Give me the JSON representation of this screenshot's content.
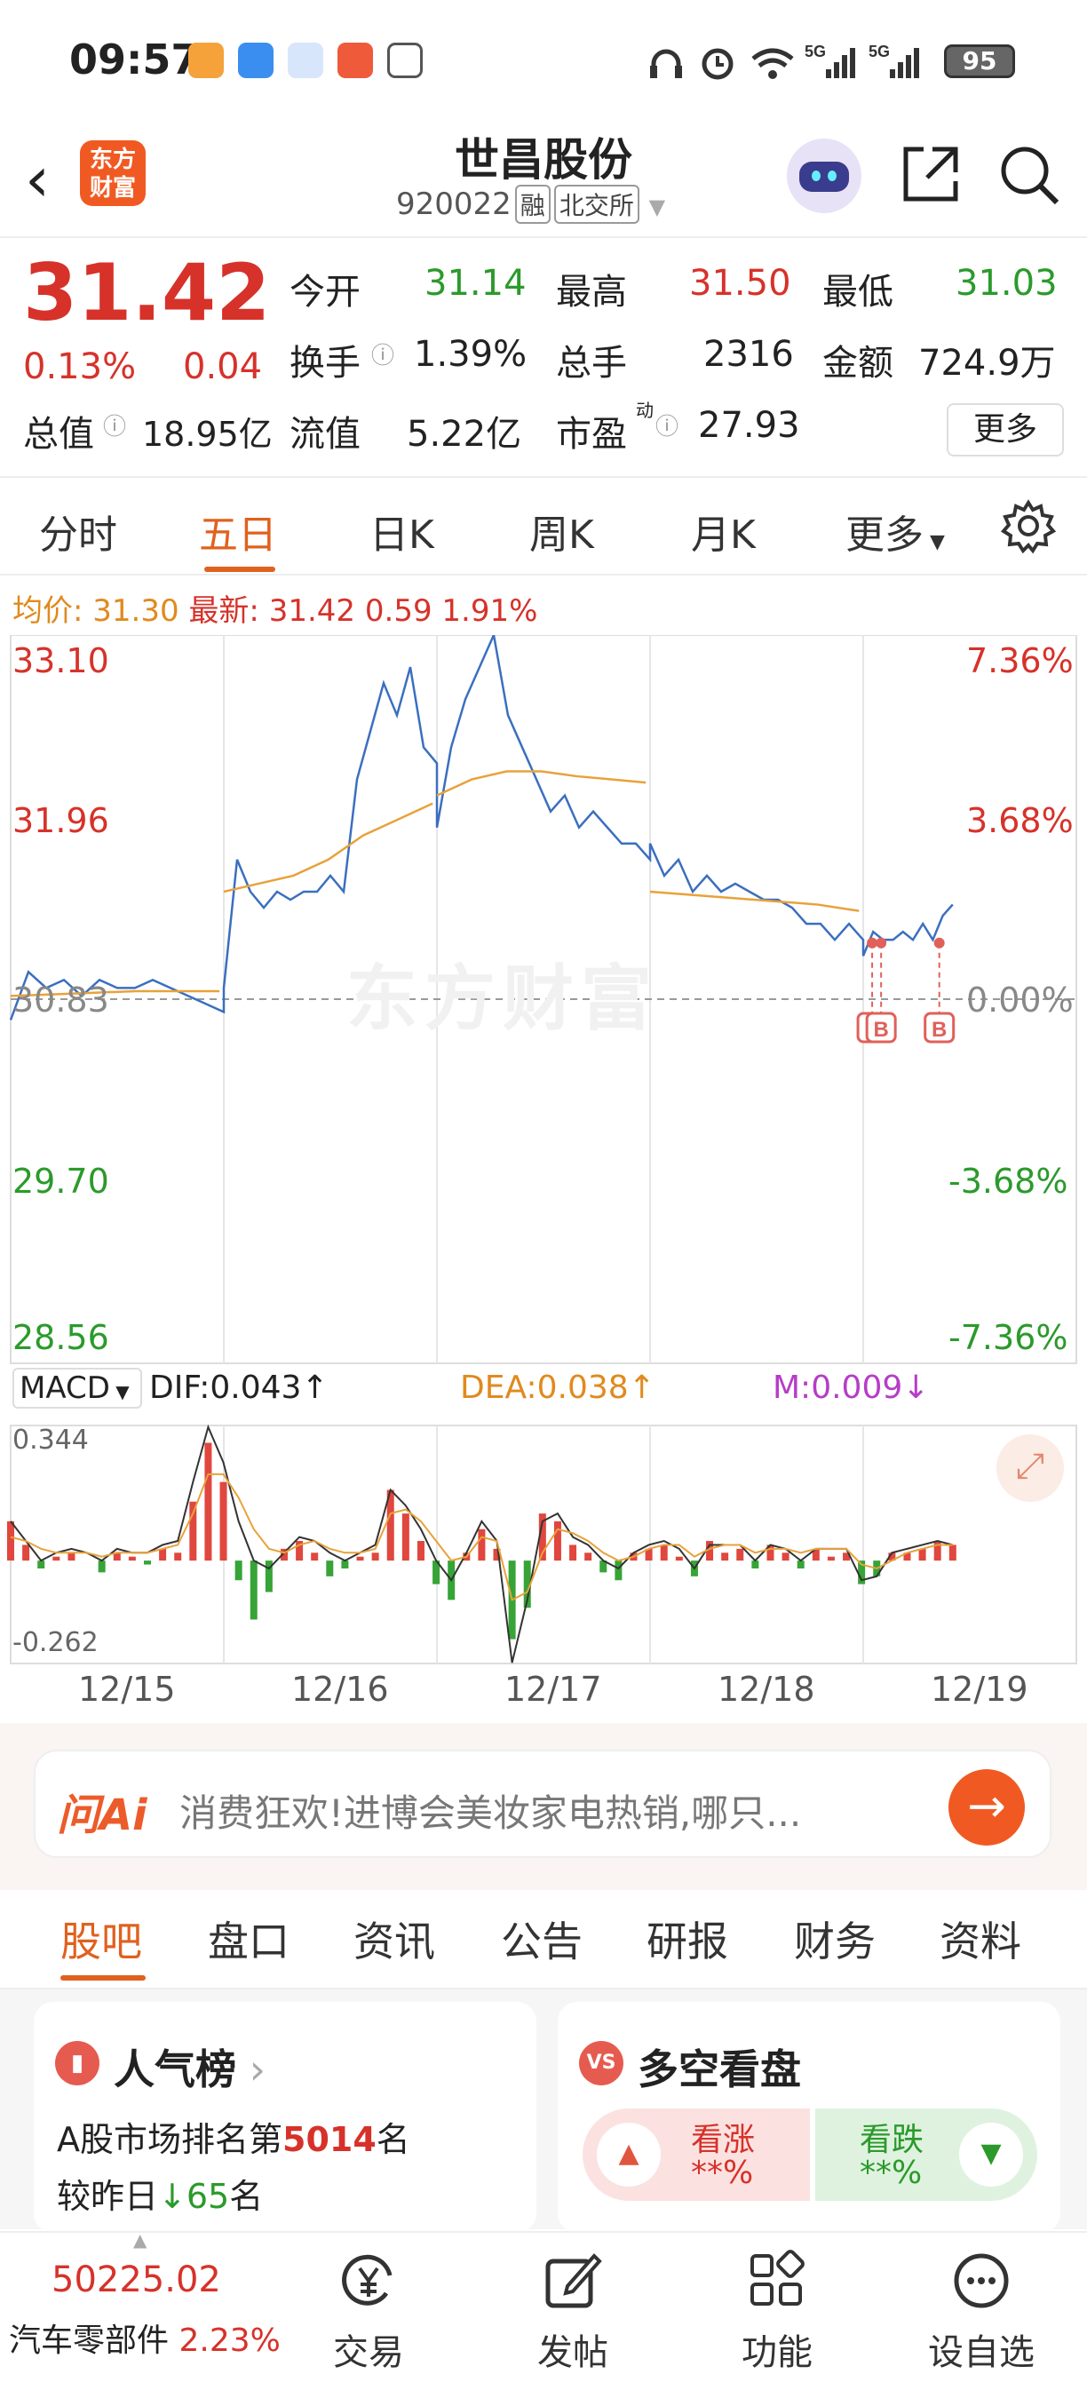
{
  "status_bar": {
    "time": "09:57",
    "network1": "5G",
    "network2": "5G",
    "battery": "95"
  },
  "header": {
    "logo_line1": "东方",
    "logo_line2": "财富",
    "stock_name": "世昌股份",
    "stock_code": "920022",
    "tag_margin": "融",
    "tag_exchange": "北交所"
  },
  "quote": {
    "price": "31.42",
    "change_pct": "0.13%",
    "change_amt": "0.04",
    "open_label": "今开",
    "open": "31.14",
    "high_label": "最高",
    "high": "31.50",
    "low_label": "最低",
    "low": "31.03",
    "turnover_label": "换手",
    "turnover": "1.39%",
    "volume_label": "总手",
    "volume": "2316",
    "amount_label": "金额",
    "amount": "724.9万",
    "mktcap_label": "总值",
    "mktcap": "18.95亿",
    "float_label": "流值",
    "float": "5.22亿",
    "pe_label": "市盈",
    "pe_sup": "动",
    "pe": "27.93",
    "more": "更多"
  },
  "tabs": [
    "分时",
    "五日",
    "日K",
    "周K",
    "月K",
    "更多"
  ],
  "info": {
    "avg_label": "均价:",
    "avg": "31.30",
    "latest_label": "最新:",
    "latest": "31.42",
    "change": "0.59",
    "change_pct": "1.91%"
  },
  "chart_data": {
    "type": "line",
    "title": "",
    "x_labels": [
      "12/15",
      "12/16",
      "12/17",
      "12/18",
      "12/19"
    ],
    "y_left_ticks": [
      "33.10",
      "31.96",
      "30.83",
      "29.70",
      "28.56"
    ],
    "y_right_ticks": [
      "7.36%",
      "3.68%",
      "0.00%",
      "-3.68%",
      "-7.36%"
    ],
    "ylim": [
      28.56,
      33.1
    ],
    "base_price": 30.83,
    "watermark": "东方财富",
    "series": [
      {
        "name": "price",
        "color": "#3b6fbf",
        "day_points": [
          [
            30.7,
            31.0,
            30.9,
            30.95,
            30.85,
            30.95,
            30.9,
            30.9,
            30.95,
            30.9,
            30.85,
            30.8,
            30.75
          ],
          [
            30.9,
            31.7,
            31.5,
            31.4,
            31.5,
            31.45,
            31.5,
            31.5,
            31.6,
            31.5,
            32.2,
            32.5,
            32.8,
            32.6,
            32.9,
            32.4,
            32.3
          ],
          [
            31.9,
            32.4,
            32.7,
            32.9,
            33.1,
            32.6,
            32.4,
            32.2,
            32.0,
            32.1,
            31.9,
            32.0,
            31.9,
            31.8,
            31.8,
            31.7
          ],
          [
            31.8,
            31.6,
            31.7,
            31.5,
            31.6,
            31.5,
            31.55,
            31.5,
            31.45,
            31.45,
            31.4,
            31.3,
            31.3,
            31.2,
            31.3,
            31.2
          ],
          [
            31.1,
            31.25,
            31.2,
            31.2,
            31.25,
            31.2,
            31.3,
            31.2,
            31.35,
            31.42
          ]
        ]
      },
      {
        "name": "avg",
        "color": "#e8a23a",
        "day_points": [
          [
            30.85,
            30.86,
            30.87,
            30.88,
            30.88,
            30.88
          ],
          [
            31.5,
            31.55,
            31.6,
            31.7,
            31.85,
            31.95,
            32.05
          ],
          [
            32.1,
            32.2,
            32.25,
            32.25,
            32.22,
            32.2,
            32.18
          ],
          [
            31.5,
            31.48,
            31.46,
            31.44,
            31.42,
            31.38
          ],
          []
        ]
      }
    ],
    "markers": [
      {
        "label": "B",
        "day": 4,
        "pos": 0.1
      },
      {
        "label": "B",
        "day": 4,
        "pos": 0.2
      },
      {
        "label": "B",
        "day": 4,
        "pos": 0.85
      }
    ]
  },
  "macd": {
    "selector": "MACD",
    "dif": "DIF:0.043",
    "dea": "DEA:0.038",
    "m": "M:0.009",
    "y_top": "0.344",
    "y_bottom": "-0.262",
    "hist": [
      0.1,
      0.04,
      -0.02,
      0.01,
      0.02,
      0.0,
      -0.03,
      0.02,
      0.01,
      -0.01,
      0.03,
      0.02,
      0.15,
      0.3,
      0.2,
      -0.05,
      -0.15,
      -0.08,
      0.03,
      0.05,
      0.02,
      -0.04,
      -0.02,
      0.01,
      0.02,
      0.18,
      0.12,
      0.05,
      -0.06,
      -0.1,
      0.02,
      0.08,
      0.03,
      -0.2,
      -0.12,
      0.12,
      0.1,
      0.04,
      0.02,
      -0.03,
      -0.05,
      0.02,
      0.03,
      0.04,
      0.01,
      -0.04,
      0.05,
      0.02,
      0.03,
      -0.02,
      0.04,
      0.02,
      -0.02,
      0.03,
      0.01,
      0.02,
      -0.06,
      -0.04,
      0.02,
      0.02,
      0.03,
      0.05,
      0.04
    ],
    "dif_series": [
      0.1,
      0.05,
      0.0,
      0.02,
      0.03,
      0.02,
      0.0,
      0.03,
      0.02,
      0.02,
      0.04,
      0.05,
      0.2,
      0.34,
      0.25,
      0.1,
      0.0,
      -0.02,
      0.02,
      0.06,
      0.05,
      0.02,
      0.0,
      0.02,
      0.04,
      0.18,
      0.14,
      0.08,
      0.0,
      -0.05,
      0.02,
      0.1,
      0.05,
      -0.26,
      -0.1,
      0.1,
      0.12,
      0.06,
      0.04,
      0.0,
      -0.02,
      0.02,
      0.04,
      0.05,
      0.03,
      -0.02,
      0.04,
      0.04,
      0.04,
      0.0,
      0.04,
      0.03,
      0.0,
      0.03,
      0.03,
      0.03,
      -0.05,
      -0.04,
      0.02,
      0.03,
      0.04,
      0.05,
      0.04
    ],
    "dea_series": [
      0.06,
      0.05,
      0.03,
      0.02,
      0.02,
      0.02,
      0.01,
      0.02,
      0.02,
      0.02,
      0.03,
      0.04,
      0.12,
      0.22,
      0.22,
      0.16,
      0.08,
      0.03,
      0.02,
      0.04,
      0.05,
      0.03,
      0.02,
      0.02,
      0.03,
      0.12,
      0.13,
      0.1,
      0.05,
      0.0,
      0.01,
      0.06,
      0.05,
      -0.1,
      -0.08,
      0.02,
      0.08,
      0.07,
      0.05,
      0.02,
      0.0,
      0.01,
      0.03,
      0.04,
      0.04,
      0.01,
      0.03,
      0.04,
      0.04,
      0.02,
      0.03,
      0.03,
      0.02,
      0.03,
      0.03,
      0.03,
      -0.01,
      -0.02,
      0.0,
      0.02,
      0.03,
      0.04,
      0.04
    ]
  },
  "ai": {
    "logo": "问Ai",
    "text": "消费狂欢!进博会美妆家电热销,哪只..."
  },
  "lower_tabs": [
    "股吧",
    "盘口",
    "资讯",
    "公告",
    "研报",
    "财务",
    "资料"
  ],
  "popularity": {
    "title": "人气榜",
    "rank_prefix": "A股市场排名第",
    "rank": "5014",
    "rank_suffix": "名",
    "delta_prefix": "较昨日",
    "delta": "65",
    "delta_suffix": "名"
  },
  "vote": {
    "title": "多空看盘",
    "icon": "VS",
    "up_label": "看涨",
    "up_value": "**%",
    "down_label": "看跌",
    "down_value": "**%"
  },
  "bottom_nav": {
    "index_value": "50225.02",
    "sector": "汽车零部件",
    "sector_pct": "2.23%",
    "trade": "交易",
    "post": "发帖",
    "function": "功能",
    "watchlist": "设自选"
  }
}
